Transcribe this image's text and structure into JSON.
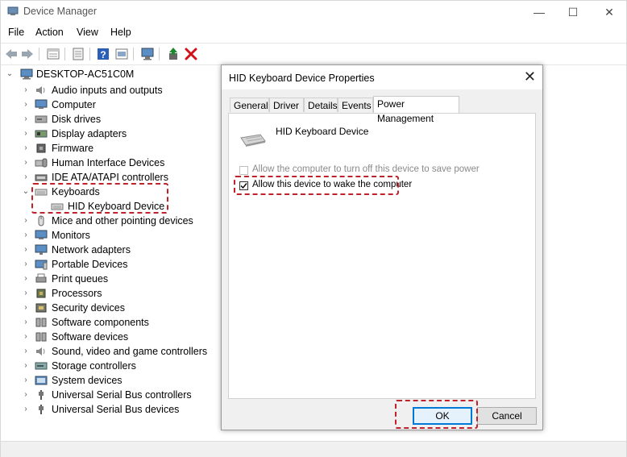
{
  "window": {
    "title": "Device Manager",
    "minimize": "—",
    "maximize": "☐",
    "close": "✕"
  },
  "menu": [
    "File",
    "Action",
    "View",
    "Help"
  ],
  "toolbar": {
    "icons": [
      "back-icon",
      "forward-icon",
      "properties-icon",
      "help-icon",
      "update-driver-icon",
      "scan-hardware-icon",
      "enable-device-icon",
      "uninstall-icon"
    ],
    "uninstall_color": "#d0121b",
    "enable_color": "#1e8a2e"
  },
  "tree": {
    "root": "DESKTOP-AC51C0M",
    "items": [
      {
        "label": "Audio inputs and outputs",
        "icon": "speaker-icon"
      },
      {
        "label": "Computer",
        "icon": "monitor-icon"
      },
      {
        "label": "Disk drives",
        "icon": "disk-icon"
      },
      {
        "label": "Display adapters",
        "icon": "display-adapter-icon"
      },
      {
        "label": "Firmware",
        "icon": "chip-icon"
      },
      {
        "label": "Human Interface Devices",
        "icon": "hid-icon"
      },
      {
        "label": "IDE ATA/ATAPI controllers",
        "icon": "ide-icon"
      },
      {
        "label": "Keyboards",
        "icon": "keyboard-icon",
        "expanded": true
      },
      {
        "label": "HID Keyboard Device",
        "icon": "keyboard-icon",
        "child": true
      },
      {
        "label": "Mice and other pointing devices",
        "icon": "mouse-icon"
      },
      {
        "label": "Monitors",
        "icon": "monitor-icon"
      },
      {
        "label": "Network adapters",
        "icon": "network-icon"
      },
      {
        "label": "Portable Devices",
        "icon": "portable-icon"
      },
      {
        "label": "Print queues",
        "icon": "printer-icon"
      },
      {
        "label": "Processors",
        "icon": "processor-icon"
      },
      {
        "label": "Security devices",
        "icon": "security-icon"
      },
      {
        "label": "Software components",
        "icon": "component-icon"
      },
      {
        "label": "Software devices",
        "icon": "component-icon"
      },
      {
        "label": "Sound, video and game controllers",
        "icon": "speaker-icon"
      },
      {
        "label": "Storage controllers",
        "icon": "storage-icon"
      },
      {
        "label": "System devices",
        "icon": "system-icon"
      },
      {
        "label": "Universal Serial Bus controllers",
        "icon": "usb-icon"
      },
      {
        "label": "Universal Serial Bus devices",
        "icon": "usb-icon"
      }
    ]
  },
  "dialog": {
    "title": "HID Keyboard Device Properties",
    "close": "✕",
    "tabs": [
      "General",
      "Driver",
      "Details",
      "Events",
      "Power Management"
    ],
    "active_tab": "Power Management",
    "device_name": "HID Keyboard Device",
    "option_turn_off": "Allow the computer to turn off this device to save power",
    "option_turn_off_checked": false,
    "option_turn_off_disabled": true,
    "option_wake": "Allow this device to wake the computer",
    "option_wake_checked": true,
    "ok": "OK",
    "cancel": "Cancel"
  },
  "highlight_color": "#c0222b"
}
